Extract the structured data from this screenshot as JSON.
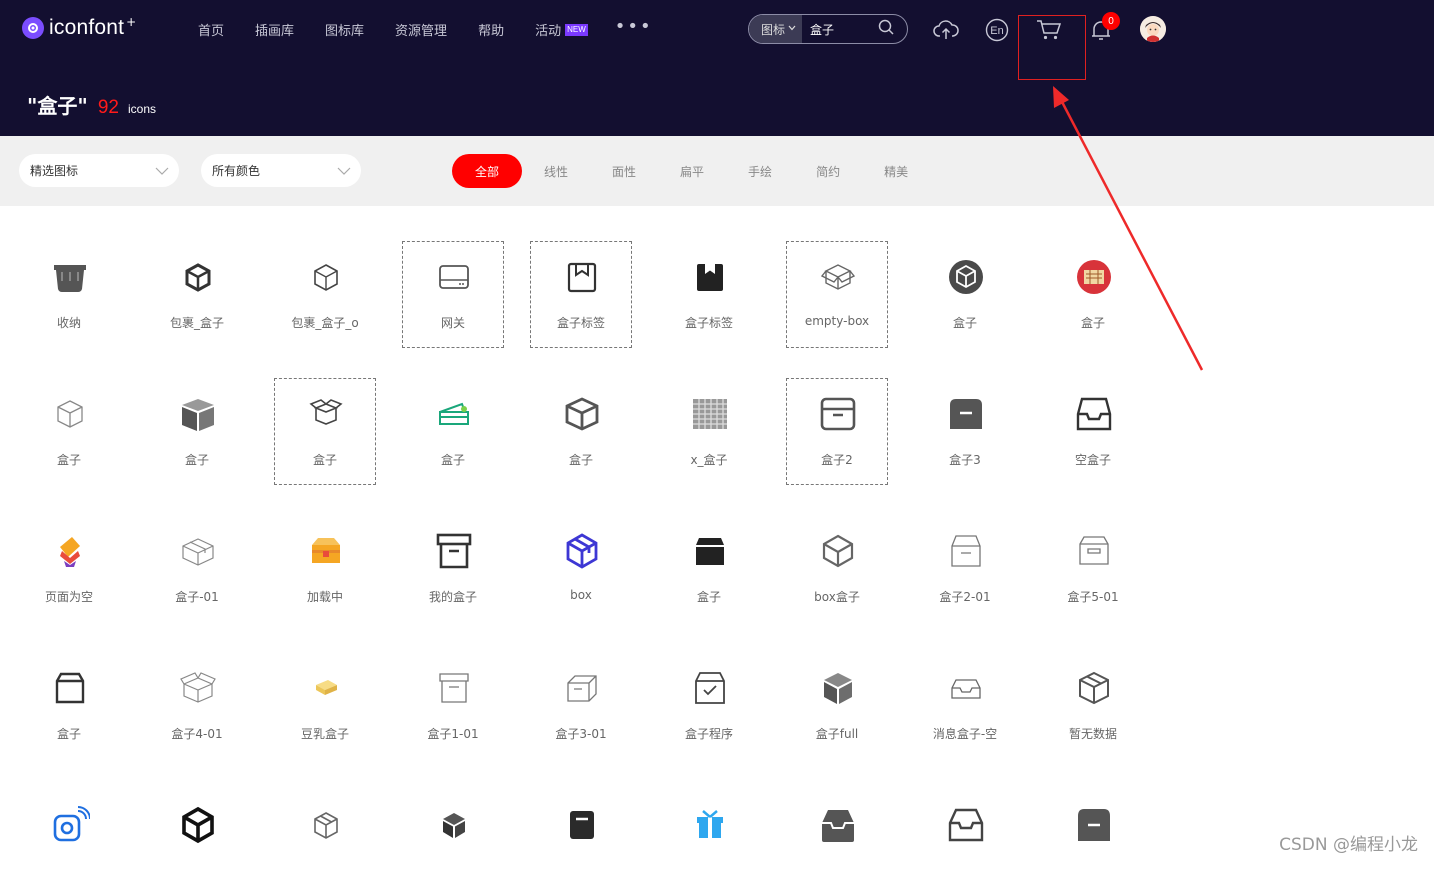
{
  "header": {
    "logo_text": "iconfont",
    "logo_sup": "+",
    "nav": [
      {
        "label": "首页"
      },
      {
        "label": "插画库"
      },
      {
        "label": "图标库"
      },
      {
        "label": "资源管理"
      },
      {
        "label": "帮助"
      },
      {
        "label": "活动",
        "badge": "NEW"
      }
    ],
    "more_label": "•••",
    "search": {
      "type_label": "图标",
      "value": "盒子"
    },
    "notification_count": "0"
  },
  "title": {
    "query": "\"盒子\"",
    "count": "92",
    "unit": "icons"
  },
  "filters": {
    "dropdown1": "精选图标",
    "dropdown2": "所有颜色",
    "styles": [
      "全部",
      "线性",
      "面性",
      "扁平",
      "手绘",
      "简约",
      "精美"
    ],
    "active_style": "全部"
  },
  "icons": [
    {
      "label": "收纳",
      "icon": "storage-bin-icon"
    },
    {
      "label": "包裹_盒子",
      "icon": "package-box-icon"
    },
    {
      "label": "包裹_盒子_o",
      "icon": "package-box-outline-icon"
    },
    {
      "label": "网关",
      "icon": "gateway-icon"
    },
    {
      "label": "盒子标签",
      "icon": "box-label-icon"
    },
    {
      "label": "盒子标签",
      "icon": "box-label-solid-icon"
    },
    {
      "label": "empty-box",
      "icon": "empty-box-icon"
    },
    {
      "label": "盒子",
      "icon": "box-circle-icon"
    },
    {
      "label": "盒子",
      "icon": "box-red-circle-icon"
    },
    {
      "label": "盒子",
      "icon": "box-outline-icon"
    },
    {
      "label": "盒子",
      "icon": "box-open-solid-icon"
    },
    {
      "label": "盒子",
      "icon": "box-open-lid-icon"
    },
    {
      "label": "盒子",
      "icon": "box-green-icon"
    },
    {
      "label": "盒子",
      "icon": "box-cube-icon"
    },
    {
      "label": "x_盒子",
      "icon": "box-grid-icon"
    },
    {
      "label": "盒子2",
      "icon": "box2-icon"
    },
    {
      "label": "盒子3",
      "icon": "box3-icon"
    },
    {
      "label": "空盒子",
      "icon": "empty-tray-icon"
    },
    {
      "label": "页面为空",
      "icon": "page-empty-icon"
    },
    {
      "label": "盒子-01",
      "icon": "box-01-icon"
    },
    {
      "label": "加载中",
      "icon": "loading-box-icon"
    },
    {
      "label": "我的盒子",
      "icon": "my-box-icon"
    },
    {
      "label": "box",
      "icon": "box-blue-icon"
    },
    {
      "label": "盒子",
      "icon": "box-black-icon"
    },
    {
      "label": "box盒子",
      "icon": "box-hex-icon"
    },
    {
      "label": "盒子2-01",
      "icon": "box2-01-icon"
    },
    {
      "label": "盒子5-01",
      "icon": "box5-01-icon"
    },
    {
      "label": "盒子",
      "icon": "box-plain-icon"
    },
    {
      "label": "盒子4-01",
      "icon": "box4-01-icon"
    },
    {
      "label": "豆乳盒子",
      "icon": "tofu-box-icon"
    },
    {
      "label": "盒子1-01",
      "icon": "box1-01-icon"
    },
    {
      "label": "盒子3-01",
      "icon": "box3-01-icon"
    },
    {
      "label": "盒子程序",
      "icon": "box-program-icon"
    },
    {
      "label": "盒子full",
      "icon": "box-full-icon"
    },
    {
      "label": "消息盒子-空",
      "icon": "message-box-empty-icon"
    },
    {
      "label": "暂无数据",
      "icon": "no-data-icon"
    },
    {
      "label": "",
      "icon": "camera-wifi-icon"
    },
    {
      "label": "",
      "icon": "cube-bold-icon"
    },
    {
      "label": "",
      "icon": "cube-outline-icon"
    },
    {
      "label": "",
      "icon": "cube-solid-icon"
    },
    {
      "label": "",
      "icon": "dark-box-icon"
    },
    {
      "label": "",
      "icon": "gift-blue-icon"
    },
    {
      "label": "",
      "icon": "tray-gray-icon"
    },
    {
      "label": "",
      "icon": "tray-outline-icon"
    },
    {
      "label": "",
      "icon": "minus-box-icon"
    }
  ],
  "dashed_cells": [
    3,
    4,
    6,
    11,
    15
  ],
  "colors": {
    "header_bg": "#130f30",
    "accent": "#ff0000",
    "annotation": "#e02020"
  },
  "watermark": "CSDN @编程小龙"
}
